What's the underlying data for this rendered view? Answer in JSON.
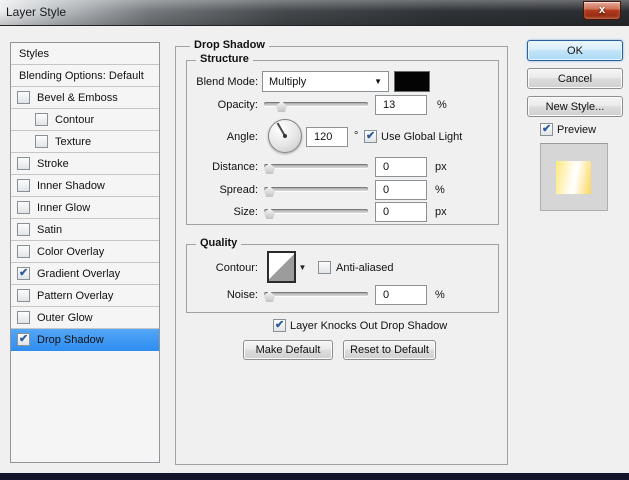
{
  "window": {
    "title": "Layer Style",
    "close_glyph": "x"
  },
  "sidebar": {
    "rows": [
      {
        "label": "Styles",
        "type": "header"
      },
      {
        "label": "Blending Options: Default",
        "type": "plain"
      },
      {
        "label": "Bevel & Emboss",
        "type": "check",
        "checked": false,
        "indent": 0
      },
      {
        "label": "Contour",
        "type": "check",
        "checked": false,
        "indent": 1
      },
      {
        "label": "Texture",
        "type": "check",
        "checked": false,
        "indent": 1
      },
      {
        "label": "Stroke",
        "type": "check",
        "checked": false,
        "indent": 0
      },
      {
        "label": "Inner Shadow",
        "type": "check",
        "checked": false,
        "indent": 0
      },
      {
        "label": "Inner Glow",
        "type": "check",
        "checked": false,
        "indent": 0
      },
      {
        "label": "Satin",
        "type": "check",
        "checked": false,
        "indent": 0
      },
      {
        "label": "Color Overlay",
        "type": "check",
        "checked": false,
        "indent": 0
      },
      {
        "label": "Gradient Overlay",
        "type": "check",
        "checked": true,
        "indent": 0
      },
      {
        "label": "Pattern Overlay",
        "type": "check",
        "checked": false,
        "indent": 0
      },
      {
        "label": "Outer Glow",
        "type": "check",
        "checked": false,
        "indent": 0
      },
      {
        "label": "Drop Shadow",
        "type": "check",
        "checked": true,
        "indent": 0,
        "selected": true
      }
    ]
  },
  "panel": {
    "title": "Drop Shadow",
    "structure": {
      "title": "Structure",
      "blend_mode_label": "Blend Mode:",
      "blend_mode_value": "Multiply",
      "opacity_label": "Opacity:",
      "opacity_value": "13",
      "opacity_unit": "%",
      "angle_label": "Angle:",
      "angle_value": "120",
      "angle_unit": "°",
      "use_global_light_label": "Use Global Light",
      "use_global_light_checked": true,
      "distance_label": "Distance:",
      "distance_value": "0",
      "distance_unit": "px",
      "spread_label": "Spread:",
      "spread_value": "0",
      "spread_unit": "%",
      "size_label": "Size:",
      "size_value": "0",
      "size_unit": "px"
    },
    "quality": {
      "title": "Quality",
      "contour_label": "Contour:",
      "anti_aliased_label": "Anti-aliased",
      "anti_aliased_checked": false,
      "noise_label": "Noise:",
      "noise_value": "0",
      "noise_unit": "%"
    },
    "knockout_label": "Layer Knocks Out Drop Shadow",
    "knockout_checked": true,
    "make_default_label": "Make Default",
    "reset_default_label": "Reset to Default"
  },
  "actions": {
    "ok": "OK",
    "cancel": "Cancel",
    "new_style": "New Style...",
    "preview": "Preview",
    "preview_checked": true
  },
  "colors": {
    "selection_blue": "#3f9bfa",
    "blend_swatch": "#000000",
    "preview_gold_light": "#fde77d",
    "preview_gold_dark": "#fcd75b"
  }
}
